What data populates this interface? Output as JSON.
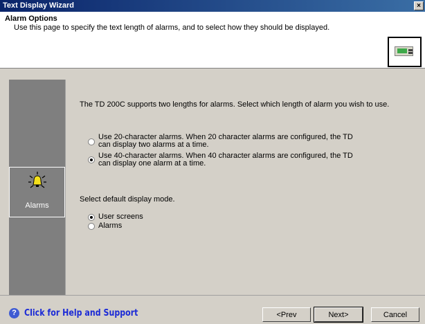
{
  "window": {
    "title": "Text Display Wizard",
    "close_label": "×"
  },
  "header": {
    "title": "Alarm Options",
    "description": "Use this page to specify the text length of alarms, and to select how they should be displayed."
  },
  "sidebar": {
    "items": [
      {
        "label": "Alarms",
        "icon": "alarm-bell-icon"
      }
    ]
  },
  "content": {
    "intro": "The TD 200C supports two lengths for alarms. Select which length of alarm you wish to use.",
    "length_options": [
      {
        "label": "Use 20-character alarms. When 20 character alarms are configured, the TD can display two alarms at a time.",
        "checked": false
      },
      {
        "label": "Use 40-character alarms. When 40 character alarms are configured, the TD can display one alarm at a time.",
        "checked": true
      }
    ],
    "mode_heading": "Select default display mode.",
    "mode_options": [
      {
        "label": "User screens",
        "checked": true
      },
      {
        "label": "Alarms",
        "checked": false
      }
    ]
  },
  "footer": {
    "help_icon": "?",
    "help_label": "Click for Help and Support",
    "prev_label": "<Prev",
    "next_label": "Next>",
    "cancel_label": "Cancel"
  }
}
